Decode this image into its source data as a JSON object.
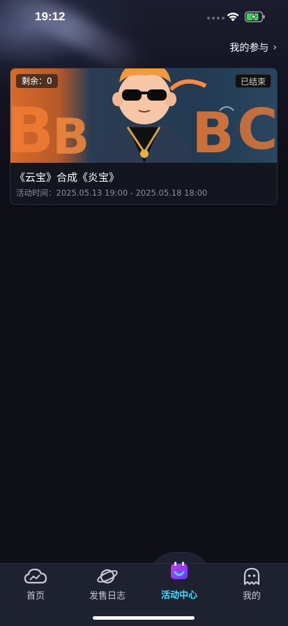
{
  "status_bar": {
    "time": "19:12"
  },
  "header": {
    "participate_label": "我的参与"
  },
  "activity": {
    "remaining_label": "剩余：0",
    "status_label": "已结束",
    "title": "《云宝》合成《炎宝》",
    "time_label": "活动时间：2025.05.13 19:00 - 2025.05.18 18:00"
  },
  "tabs": [
    {
      "label": "首页",
      "icon": "cloud-icon",
      "active": false
    },
    {
      "label": "发售日志",
      "icon": "planet-icon",
      "active": false
    },
    {
      "label": "活动中心",
      "icon": "calendar-icon",
      "active": true
    },
    {
      "label": "我的",
      "icon": "ghost-icon",
      "active": false
    }
  ],
  "colors": {
    "background": "#0f0f17",
    "accent": "#3ee0ff",
    "tab_bar": "#1e2130"
  }
}
